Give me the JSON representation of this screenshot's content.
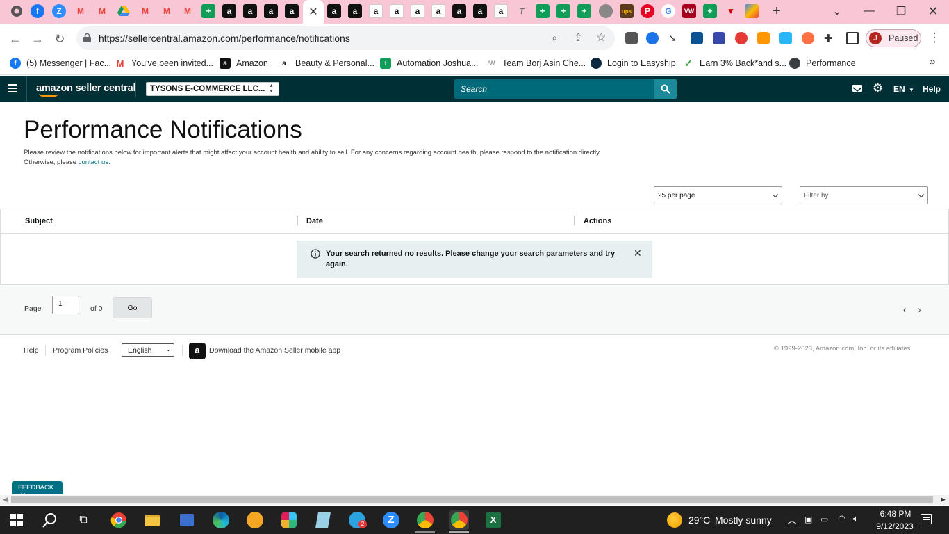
{
  "browser": {
    "url": "https://sellercentral.amazon.com/performance/notifications",
    "paused_label": "Paused",
    "profile_initial": "J",
    "new_tab_symbol": "+"
  },
  "bookmarks": [
    {
      "label": "(5) Messenger | Fac...",
      "icon": "facebook-icon",
      "color": "#1877f2"
    },
    {
      "label": "You've been invited...",
      "icon": "gmail-icon",
      "color": "#ea4335"
    },
    {
      "label": "Amazon",
      "icon": "amazon-icon",
      "color": "#111111"
    },
    {
      "label": "Beauty & Personal...",
      "icon": "amazon-smile-icon",
      "color": "#ffffff"
    },
    {
      "label": "Automation Joshua...",
      "icon": "sheets-icon",
      "color": "#0f9d58"
    },
    {
      "label": "Team Borj Asin Che...",
      "icon": "team-icon",
      "color": "#cccccc"
    },
    {
      "label": "Login to Easyship",
      "icon": "easyship-icon",
      "color": "#0b2941"
    },
    {
      "label": "Earn 3% Back*and s...",
      "icon": "check-icon",
      "color": "#3a9c3a"
    },
    {
      "label": "Performance",
      "icon": "globe-icon",
      "color": "#3c4043"
    }
  ],
  "header": {
    "logo_text": "amazon seller central",
    "store_name": "TYSONS E-COMMERCE LLC...",
    "search_placeholder": "Search",
    "language": "EN",
    "help": "Help"
  },
  "page": {
    "title": "Performance Notifications",
    "description": "Please review the notifications below for important alerts that might affect your account health and ability to sell. For any concerns regarding account health, please respond to the notification directly. Otherwise, please",
    "contact_link": "contact us."
  },
  "controls": {
    "per_page": "25 per page",
    "filter_placeholder": "Filter by"
  },
  "table": {
    "columns": [
      "Subject",
      "Date",
      "Actions"
    ],
    "no_results": "Your search returned no results. Please change your search parameters and try again."
  },
  "pagination": {
    "page_label": "Page",
    "page_value": "1",
    "of_label": "of 0",
    "go_label": "Go"
  },
  "footer": {
    "help": "Help",
    "policies": "Program Policies",
    "language": "English",
    "app_text": "Download the Amazon Seller mobile app",
    "copyright": "© 1999-2023, Amazon.com, Inc. or its affiliates"
  },
  "feedback_label": "FEEDBACK",
  "taskbar": {
    "temperature": "29°C",
    "weather": "Mostly sunny",
    "time": "6:48 PM",
    "date": "9/12/2023",
    "telegram_badge": "2"
  },
  "colors": {
    "header_bg": "#002f36",
    "search_bg": "#00697a",
    "link": "#007185",
    "alert_bg": "#e6f0f0",
    "tabstrip": "#f9c6d6"
  }
}
